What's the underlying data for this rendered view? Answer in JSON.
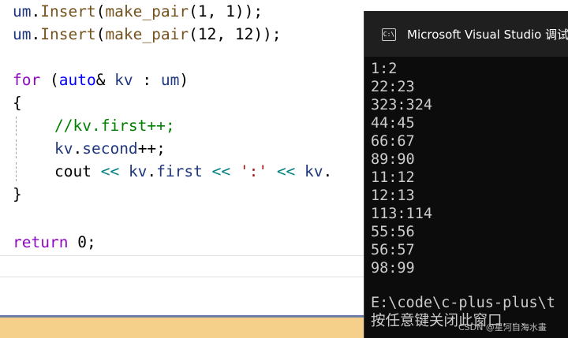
{
  "editor": {
    "l1": {
      "obj": "um",
      "dot": ".",
      "fn": "Insert",
      "p1": "(",
      "fn2": "make_pair",
      "p2": "(",
      "n1": "1",
      ",": ", ",
      "n2": "1",
      "end": "));"
    },
    "l2": {
      "obj": "um",
      "dot": ".",
      "fn": "Insert",
      "p1": "(",
      "fn2": "make_pair",
      "p2": "(",
      "n1": "12",
      ",": ", ",
      "n2": "12",
      "end": "));"
    },
    "l4": {
      "kw": "for",
      "sp": " (",
      "type": "auto",
      "amp": "&",
      "var": " kv",
      "colon": " : ",
      "obj": "um",
      "close": ")"
    },
    "l5": "{",
    "l6": "//kv.first++;",
    "l7": {
      "obj": "kv",
      "dot": ".",
      "mem": "second",
      "rest": "++;"
    },
    "l8": {
      "cout": "cout",
      "op1": " << ",
      "kv": "kv",
      "dot": ".",
      "mem": "first",
      "op2": " << ",
      "str": "':'",
      "op3": " << ",
      "kv2": "kv",
      "dot2": "."
    },
    "l9": "}",
    "l11": {
      "kw": "return",
      "num": " 0",
      "semi": ";"
    }
  },
  "console": {
    "title": "Microsoft Visual Studio 调试控",
    "icon_label": "C:\\",
    "output": [
      "1:2",
      "22:23",
      "323:324",
      "44:45",
      "66:67",
      "89:90",
      "11:12",
      "12:13",
      "113:114",
      "55:56",
      "56:57",
      "98:99"
    ],
    "path_line": "E:\\code\\c-plus-plus\\t",
    "press_key": "按任意键关闭此窗口. . ."
  },
  "watermark": "CSDN @星河自海水畫",
  "colors": {
    "status_bar": "#f5d08a",
    "console_bg": "#0c0c0c",
    "keyword": "#8f08c4",
    "type": "#0000ff",
    "comment": "#008000"
  }
}
